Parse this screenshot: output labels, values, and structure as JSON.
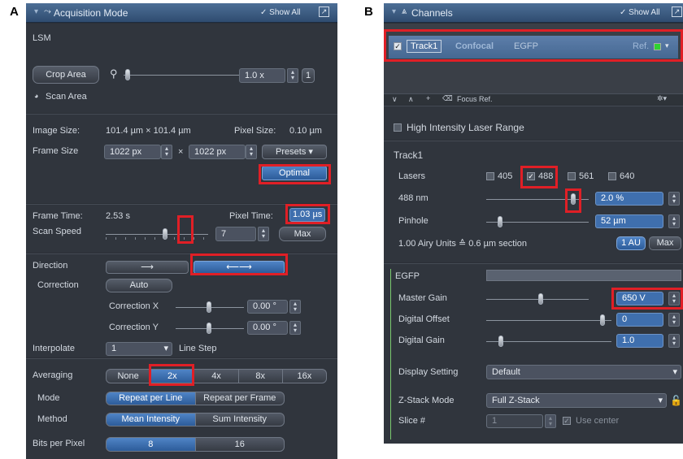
{
  "figure_labels": {
    "a": "A",
    "b": "B"
  },
  "panel_a": {
    "title": "Acquisition Mode",
    "show_all": "✓ Show All",
    "mode": "LSM",
    "crop_area": "Crop Area",
    "zoom": "1.0 x",
    "zoom_reset": "1",
    "scan_area": "Scan Area",
    "image_size_label": "Image Size:",
    "image_size_value": "101.4 µm × 101.4 µm",
    "pixel_size_label": "Pixel Size:",
    "pixel_size_value": "0.10 µm",
    "frame_size_label": "Frame Size",
    "frame_x": "1022 px",
    "frame_times": "×",
    "frame_y": "1022 px",
    "presets": "Presets",
    "optimal": "Optimal",
    "frame_time_label": "Frame Time:",
    "frame_time_value": "2.53 s",
    "pixel_time_label": "Pixel Time:",
    "pixel_time_value": "1.03 µs",
    "scan_speed_label": "Scan Speed",
    "scan_speed_value": "7",
    "scan_speed_level": 0.58,
    "max": "Max",
    "direction_label": "Direction",
    "direction_options": [
      "⟶",
      "⟵⟶"
    ],
    "correction_label": "Correction",
    "correction_value": "Auto",
    "correction_x_label": "Correction X",
    "correction_x_value": "0.00 °",
    "correction_y_label": "Correction Y",
    "correction_y_value": "0.00 °",
    "interpolate_label": "Interpolate",
    "interpolate_value": "1",
    "line_step": "Line Step",
    "averaging_label": "Averaging",
    "averaging_options": [
      "None",
      "2x",
      "4x",
      "8x",
      "16x"
    ],
    "mode_label": "Mode",
    "mode_options": [
      "Repeat per Line",
      "Repeat per Frame"
    ],
    "method_label": "Method",
    "method_options": [
      "Mean Intensity",
      "Sum Intensity"
    ],
    "bits_label": "Bits per Pixel",
    "bits_options": [
      "8",
      "16"
    ]
  },
  "panel_b": {
    "title": "Channels",
    "show_all": "✓ Show All",
    "track_name": "Track1",
    "track_mode": "Confocal",
    "track_dye": "EGFP",
    "ref": "Ref.",
    "focus_ref": "Focus Ref.",
    "high_intensity": "High Intensity Laser Range",
    "track_heading": "Track1",
    "lasers_label": "Lasers",
    "lasers": [
      {
        "label": "405",
        "checked": false
      },
      {
        "label": "488",
        "checked": true
      },
      {
        "label": "561",
        "checked": false
      },
      {
        "label": "640",
        "checked": false
      }
    ],
    "laser_488_label": "488 nm",
    "laser_488_value": "2.0 %",
    "pinhole_label": "Pinhole",
    "pinhole_value": "52 µm",
    "airy_text": "1.00 Airy Units ≙ 0.6 µm section",
    "au_button": "1 AU",
    "max": "Max",
    "channel_name": "EGFP",
    "master_gain_label": "Master Gain",
    "master_gain_value": "650 V",
    "digital_offset_label": "Digital Offset",
    "digital_offset_value": "0",
    "digital_gain_label": "Digital Gain",
    "digital_gain_value": "1.0",
    "display_setting_label": "Display Setting",
    "display_setting_value": "Default",
    "zstack_label": "Z-Stack Mode",
    "zstack_value": "Full Z-Stack",
    "slice_label": "Slice #",
    "slice_value": "1",
    "use_center": "Use center"
  },
  "colors": {
    "highlight": "#e01f26",
    "accent": "#3f6fae",
    "panel": "#2b2f36"
  }
}
